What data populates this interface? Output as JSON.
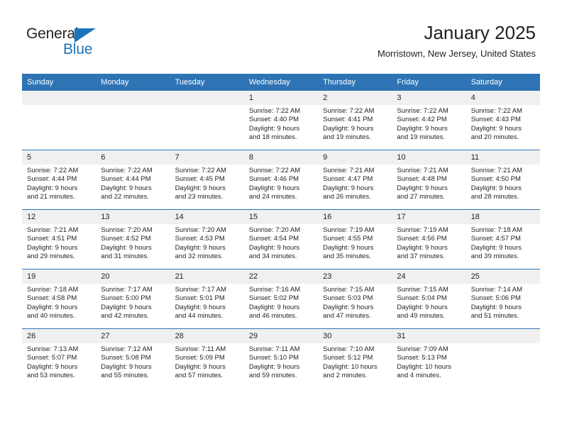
{
  "brand": {
    "name_part1": "General",
    "name_part2": "Blue",
    "accent_color": "#1b75bb"
  },
  "header": {
    "title": "January 2025",
    "subtitle": "Morristown, New Jersey, United States",
    "header_bg_color": "#2e74b5",
    "daynum_bg_color": "#f0f0f0"
  },
  "weekday_headers": [
    "Sunday",
    "Monday",
    "Tuesday",
    "Wednesday",
    "Thursday",
    "Friday",
    "Saturday"
  ],
  "weeks": [
    [
      {
        "day": "",
        "empty": true,
        "sunrise": "",
        "sunset": "",
        "daylight1": "",
        "daylight2": ""
      },
      {
        "day": "",
        "empty": true,
        "sunrise": "",
        "sunset": "",
        "daylight1": "",
        "daylight2": ""
      },
      {
        "day": "",
        "empty": true,
        "sunrise": "",
        "sunset": "",
        "daylight1": "",
        "daylight2": ""
      },
      {
        "day": "1",
        "empty": false,
        "sunrise": "Sunrise: 7:22 AM",
        "sunset": "Sunset: 4:40 PM",
        "daylight1": "Daylight: 9 hours",
        "daylight2": "and 18 minutes."
      },
      {
        "day": "2",
        "empty": false,
        "sunrise": "Sunrise: 7:22 AM",
        "sunset": "Sunset: 4:41 PM",
        "daylight1": "Daylight: 9 hours",
        "daylight2": "and 19 minutes."
      },
      {
        "day": "3",
        "empty": false,
        "sunrise": "Sunrise: 7:22 AM",
        "sunset": "Sunset: 4:42 PM",
        "daylight1": "Daylight: 9 hours",
        "daylight2": "and 19 minutes."
      },
      {
        "day": "4",
        "empty": false,
        "sunrise": "Sunrise: 7:22 AM",
        "sunset": "Sunset: 4:43 PM",
        "daylight1": "Daylight: 9 hours",
        "daylight2": "and 20 minutes."
      }
    ],
    [
      {
        "day": "5",
        "empty": false,
        "sunrise": "Sunrise: 7:22 AM",
        "sunset": "Sunset: 4:44 PM",
        "daylight1": "Daylight: 9 hours",
        "daylight2": "and 21 minutes."
      },
      {
        "day": "6",
        "empty": false,
        "sunrise": "Sunrise: 7:22 AM",
        "sunset": "Sunset: 4:44 PM",
        "daylight1": "Daylight: 9 hours",
        "daylight2": "and 22 minutes."
      },
      {
        "day": "7",
        "empty": false,
        "sunrise": "Sunrise: 7:22 AM",
        "sunset": "Sunset: 4:45 PM",
        "daylight1": "Daylight: 9 hours",
        "daylight2": "and 23 minutes."
      },
      {
        "day": "8",
        "empty": false,
        "sunrise": "Sunrise: 7:22 AM",
        "sunset": "Sunset: 4:46 PM",
        "daylight1": "Daylight: 9 hours",
        "daylight2": "and 24 minutes."
      },
      {
        "day": "9",
        "empty": false,
        "sunrise": "Sunrise: 7:21 AM",
        "sunset": "Sunset: 4:47 PM",
        "daylight1": "Daylight: 9 hours",
        "daylight2": "and 26 minutes."
      },
      {
        "day": "10",
        "empty": false,
        "sunrise": "Sunrise: 7:21 AM",
        "sunset": "Sunset: 4:48 PM",
        "daylight1": "Daylight: 9 hours",
        "daylight2": "and 27 minutes."
      },
      {
        "day": "11",
        "empty": false,
        "sunrise": "Sunrise: 7:21 AM",
        "sunset": "Sunset: 4:50 PM",
        "daylight1": "Daylight: 9 hours",
        "daylight2": "and 28 minutes."
      }
    ],
    [
      {
        "day": "12",
        "empty": false,
        "sunrise": "Sunrise: 7:21 AM",
        "sunset": "Sunset: 4:51 PM",
        "daylight1": "Daylight: 9 hours",
        "daylight2": "and 29 minutes."
      },
      {
        "day": "13",
        "empty": false,
        "sunrise": "Sunrise: 7:20 AM",
        "sunset": "Sunset: 4:52 PM",
        "daylight1": "Daylight: 9 hours",
        "daylight2": "and 31 minutes."
      },
      {
        "day": "14",
        "empty": false,
        "sunrise": "Sunrise: 7:20 AM",
        "sunset": "Sunset: 4:53 PM",
        "daylight1": "Daylight: 9 hours",
        "daylight2": "and 32 minutes."
      },
      {
        "day": "15",
        "empty": false,
        "sunrise": "Sunrise: 7:20 AM",
        "sunset": "Sunset: 4:54 PM",
        "daylight1": "Daylight: 9 hours",
        "daylight2": "and 34 minutes."
      },
      {
        "day": "16",
        "empty": false,
        "sunrise": "Sunrise: 7:19 AM",
        "sunset": "Sunset: 4:55 PM",
        "daylight1": "Daylight: 9 hours",
        "daylight2": "and 35 minutes."
      },
      {
        "day": "17",
        "empty": false,
        "sunrise": "Sunrise: 7:19 AM",
        "sunset": "Sunset: 4:56 PM",
        "daylight1": "Daylight: 9 hours",
        "daylight2": "and 37 minutes."
      },
      {
        "day": "18",
        "empty": false,
        "sunrise": "Sunrise: 7:18 AM",
        "sunset": "Sunset: 4:57 PM",
        "daylight1": "Daylight: 9 hours",
        "daylight2": "and 39 minutes."
      }
    ],
    [
      {
        "day": "19",
        "empty": false,
        "sunrise": "Sunrise: 7:18 AM",
        "sunset": "Sunset: 4:58 PM",
        "daylight1": "Daylight: 9 hours",
        "daylight2": "and 40 minutes."
      },
      {
        "day": "20",
        "empty": false,
        "sunrise": "Sunrise: 7:17 AM",
        "sunset": "Sunset: 5:00 PM",
        "daylight1": "Daylight: 9 hours",
        "daylight2": "and 42 minutes."
      },
      {
        "day": "21",
        "empty": false,
        "sunrise": "Sunrise: 7:17 AM",
        "sunset": "Sunset: 5:01 PM",
        "daylight1": "Daylight: 9 hours",
        "daylight2": "and 44 minutes."
      },
      {
        "day": "22",
        "empty": false,
        "sunrise": "Sunrise: 7:16 AM",
        "sunset": "Sunset: 5:02 PM",
        "daylight1": "Daylight: 9 hours",
        "daylight2": "and 46 minutes."
      },
      {
        "day": "23",
        "empty": false,
        "sunrise": "Sunrise: 7:15 AM",
        "sunset": "Sunset: 5:03 PM",
        "daylight1": "Daylight: 9 hours",
        "daylight2": "and 47 minutes."
      },
      {
        "day": "24",
        "empty": false,
        "sunrise": "Sunrise: 7:15 AM",
        "sunset": "Sunset: 5:04 PM",
        "daylight1": "Daylight: 9 hours",
        "daylight2": "and 49 minutes."
      },
      {
        "day": "25",
        "empty": false,
        "sunrise": "Sunrise: 7:14 AM",
        "sunset": "Sunset: 5:06 PM",
        "daylight1": "Daylight: 9 hours",
        "daylight2": "and 51 minutes."
      }
    ],
    [
      {
        "day": "26",
        "empty": false,
        "sunrise": "Sunrise: 7:13 AM",
        "sunset": "Sunset: 5:07 PM",
        "daylight1": "Daylight: 9 hours",
        "daylight2": "and 53 minutes."
      },
      {
        "day": "27",
        "empty": false,
        "sunrise": "Sunrise: 7:12 AM",
        "sunset": "Sunset: 5:08 PM",
        "daylight1": "Daylight: 9 hours",
        "daylight2": "and 55 minutes."
      },
      {
        "day": "28",
        "empty": false,
        "sunrise": "Sunrise: 7:11 AM",
        "sunset": "Sunset: 5:09 PM",
        "daylight1": "Daylight: 9 hours",
        "daylight2": "and 57 minutes."
      },
      {
        "day": "29",
        "empty": false,
        "sunrise": "Sunrise: 7:11 AM",
        "sunset": "Sunset: 5:10 PM",
        "daylight1": "Daylight: 9 hours",
        "daylight2": "and 59 minutes."
      },
      {
        "day": "30",
        "empty": false,
        "sunrise": "Sunrise: 7:10 AM",
        "sunset": "Sunset: 5:12 PM",
        "daylight1": "Daylight: 10 hours",
        "daylight2": "and 2 minutes."
      },
      {
        "day": "31",
        "empty": false,
        "sunrise": "Sunrise: 7:09 AM",
        "sunset": "Sunset: 5:13 PM",
        "daylight1": "Daylight: 10 hours",
        "daylight2": "and 4 minutes."
      },
      {
        "day": "",
        "empty": true,
        "sunrise": "",
        "sunset": "",
        "daylight1": "",
        "daylight2": ""
      }
    ]
  ]
}
